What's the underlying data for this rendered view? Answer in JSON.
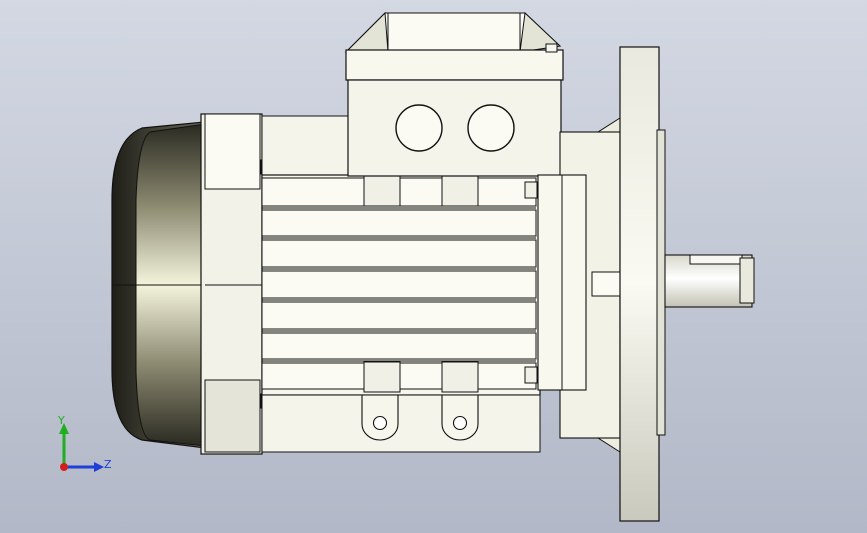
{
  "viewport": {
    "background_top": "#d3d8e3",
    "background_bottom": "#b2b8c7"
  },
  "model": {
    "description_icon": "electric-motor-side-view",
    "body_color": "#f3f3ea",
    "edge_color": "#1a1a1a",
    "cover_color": "#6e6c5a"
  },
  "triad": {
    "y_label": "Y",
    "z_label": "Z",
    "y_color": "#1fae1f",
    "z_color": "#1f3fd6",
    "x_color": "#d41f1f"
  }
}
